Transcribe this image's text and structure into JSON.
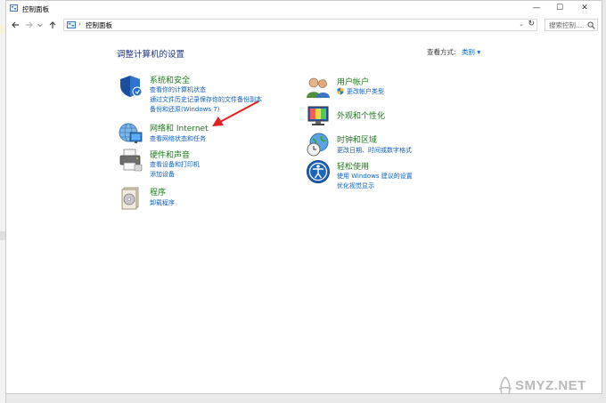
{
  "window": {
    "title": "控制面板",
    "buttons": {
      "minimize": "—",
      "maximize": "☐",
      "close": "✕"
    }
  },
  "address": {
    "crumb": "控制面板",
    "search_placeholder": "搜索控制..."
  },
  "main": {
    "heading": "调整计算机的设置",
    "view_by_label": "查看方式:",
    "view_by_value": "类别 ▾"
  },
  "categories": {
    "system_security": {
      "title": "系统和安全",
      "links": [
        "查看你的计算机状态",
        "通过文件历史记录保存你的文件备份副本",
        "备份和还原(Windows 7)"
      ]
    },
    "network": {
      "title": "网络和 Internet",
      "links": [
        "查看网络状态和任务"
      ]
    },
    "hardware": {
      "title": "硬件和声音",
      "links": [
        "查看设备和打印机",
        "添加设备"
      ]
    },
    "programs": {
      "title": "程序",
      "links": [
        "卸载程序"
      ]
    },
    "user_accounts": {
      "title": "用户帐户",
      "links": [
        "更改帐户类型"
      ]
    },
    "appearance": {
      "title": "外观和个性化",
      "links": []
    },
    "clock_region": {
      "title": "时钟和区域",
      "links": [
        "更改日期、时间或数字格式"
      ]
    },
    "ease_access": {
      "title": "轻松使用",
      "links": [
        "使用 Windows 建议的设置",
        "优化视觉显示"
      ]
    }
  },
  "watermark": {
    "text": "SMYZ.NET"
  },
  "colors": {
    "heading": "#1e3287",
    "category_title": "#1c7a1c",
    "link": "#0b5fc4",
    "arrow": "#e02020"
  }
}
